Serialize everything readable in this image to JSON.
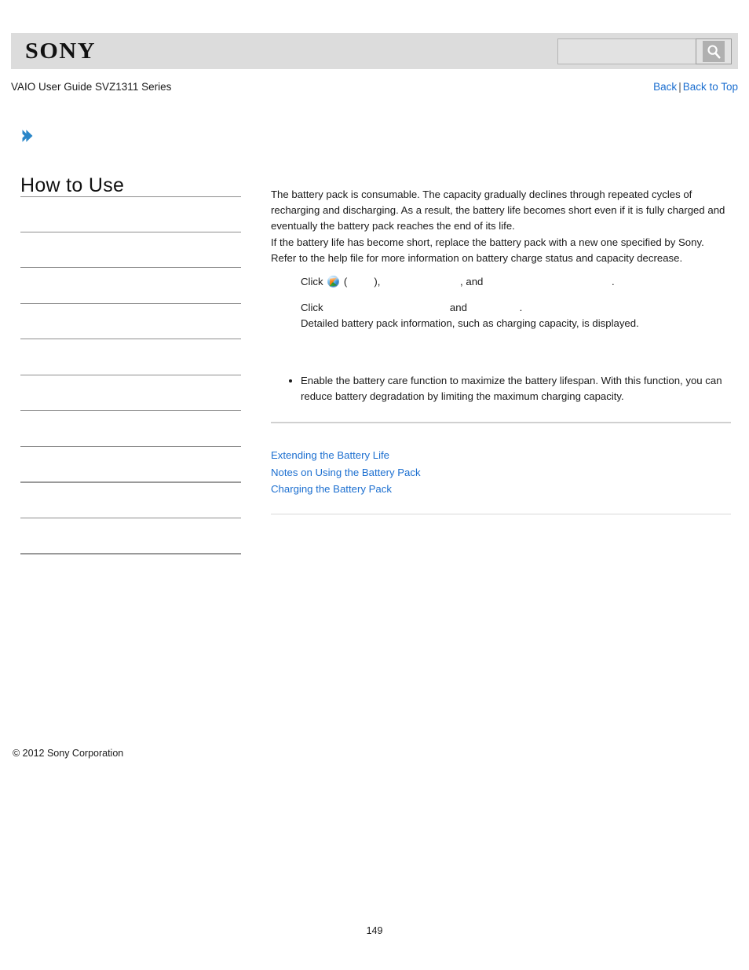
{
  "header": {
    "logo_text": "SONY",
    "search": {
      "value": "",
      "placeholder": "",
      "button_icon": "search-icon"
    }
  },
  "subheader": {
    "guide_title": "VAIO User Guide SVZ1311 Series",
    "back_label": "Back",
    "separator": "|",
    "back_to_top_label": "Back to Top"
  },
  "sidebar": {
    "chevron_icon": "chevron-right-icon",
    "title": "How to Use",
    "items": [
      "",
      "",
      "",
      "",
      "",
      "",
      "",
      "",
      "",
      ""
    ],
    "copyright": "© 2012 Sony Corporation"
  },
  "main": {
    "intro_paragraph": "The battery pack is consumable. The capacity gradually declines through repeated cycles of recharging and discharging. As a result, the battery life becomes short even if it is fully charged and eventually the battery pack reaches the end of its life.\nIf the battery life has become short, replace the battery pack with a new one specified by Sony. Refer to the help file for more information on battery charge status and capacity decrease.",
    "steps": [
      {
        "prefix": "Click ",
        "icon": "windows-start-orb-icon",
        "segment_2": " (",
        "blank_1": "",
        "segment_3": "), ",
        "blank_2": "",
        "segment_4": ", and ",
        "blank_3": "",
        "segment_5": "."
      },
      {
        "prefix": "Click ",
        "blank_1": "",
        "segment_2": " and ",
        "blank_2": "",
        "segment_3": "."
      },
      {
        "text": "Detailed battery pack information, such as charging capacity, is displayed."
      }
    ],
    "bullets": [
      "Enable the battery care function to maximize the battery lifespan. With this function, you can reduce battery degradation by limiting the maximum charging capacity."
    ],
    "related_links": [
      "Extending the Battery Life",
      "Notes on Using the Battery Pack",
      "Charging the Battery Pack"
    ]
  },
  "footer": {
    "page_number": "149"
  },
  "colors": {
    "link": "#1c6fd0",
    "header_band": "#dcdcdc",
    "accent_chevron": "#2a86c8",
    "rule": "#8e8e8e"
  }
}
